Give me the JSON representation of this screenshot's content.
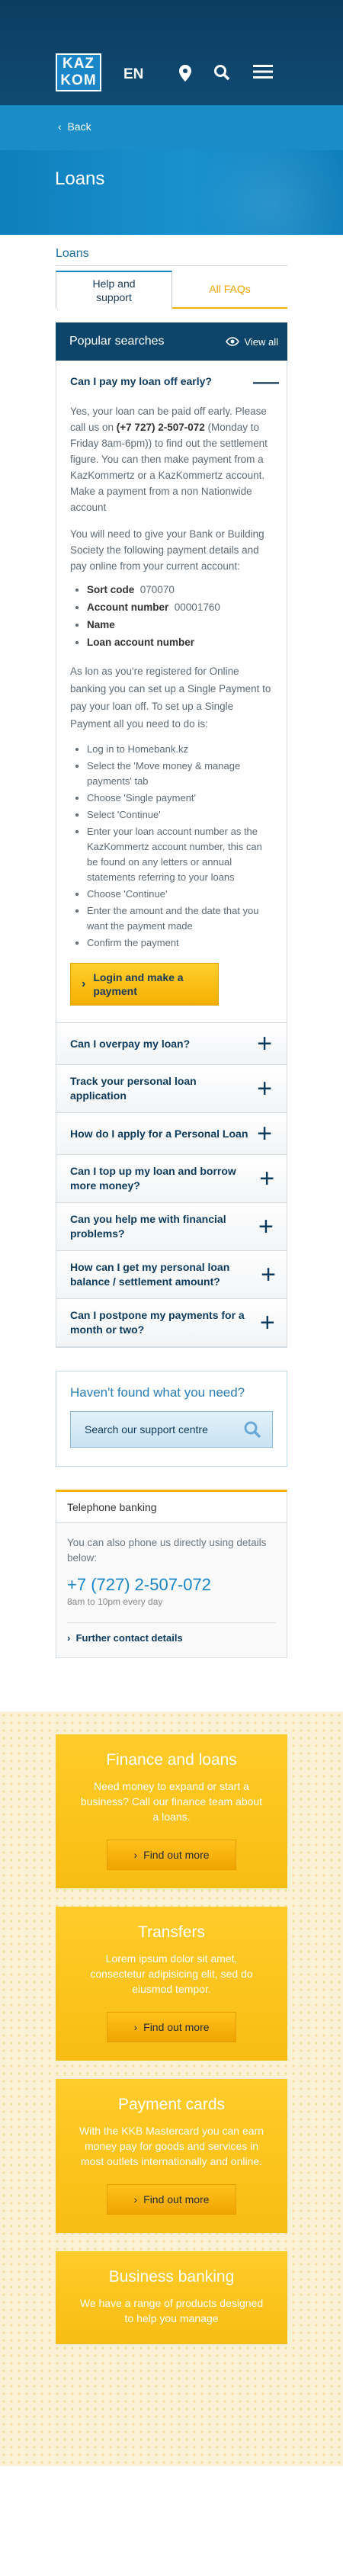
{
  "header": {
    "logo_top": "KAZ",
    "logo_bottom": "KOM",
    "lang": "EN",
    "icons": [
      "location-icon",
      "search-icon",
      "menu-icon"
    ]
  },
  "back_label": "Back",
  "page_title": "Loans",
  "breadcrumb": "Loans",
  "tabs": [
    {
      "label": "Help and support",
      "active": true
    },
    {
      "label": "All FAQs",
      "active": false
    }
  ],
  "faq": {
    "title": "Popular searches",
    "view_all": "View all",
    "open_question": "Can I pay my loan off early?",
    "answer": {
      "p1_a": "Yes, your loan can be paid off early. Please call us on ",
      "p1_phone": "(+7 727) 2-507-072",
      "p1_b": " (Monday to Friday 8am-6pm)) to find out the settlement figure. You can then make payment from a KazKommertz or a KazKommertz account.",
      "p2": "Make a payment from a non Nationwide account",
      "p3": "You will need to give your Bank or Building Society the following payment details and pay online from your current account:",
      "details": [
        {
          "label": "Sort code",
          "value": "070070"
        },
        {
          "label": "Account number",
          "value": "00001760"
        },
        {
          "label": "Name",
          "value": ""
        },
        {
          "label": "Loan account number",
          "value": ""
        }
      ],
      "p4": "As lon as you're registered for Online banking you can set up a Single Payment to pay your loan off. To set up a Single Payment all you need to do is:",
      "steps": [
        "Log in to Homebank.kz",
        "Select the 'Move money & manage payments' tab",
        "Choose 'Single payment'",
        "Select 'Continue'",
        "Enter your loan account number as the KazKommertz account number, this can be found on any letters or annual statements referring to your loans",
        "Choose 'Continue'",
        "Enter the amount and the date that you want the payment made",
        "Confirm the payment"
      ],
      "cta": "Login and make a payment"
    },
    "questions": [
      "Can I overpay my loan?",
      "Track your personal loan application",
      "How do I apply for a Personal Loan",
      "Can I top up my loan and borrow more money?",
      "Can you help me with financial problems?",
      "How can I get my personal loan balance / settlement amount?",
      "Can I postpone my payments for a month or two?"
    ]
  },
  "support": {
    "title": "Haven't found what you need?",
    "search_label": "Search our support centre"
  },
  "telephone": {
    "title": "Telephone banking",
    "text": "You can also phone us directly using details below:",
    "number": "+7 (727) 2-507-072",
    "hours": "8am to 10pm every day",
    "link": "Further contact details"
  },
  "promos": [
    {
      "title": "Finance and loans",
      "text": "Need money to expand or start a business? Call our finance team about a loans.",
      "button": "Find out more"
    },
    {
      "title": "Transfers",
      "text": "Lorem ipsum dolor sit amet, consectetur adipisicing elit, sed do eiusmod tempor.",
      "button": "Find out more"
    },
    {
      "title": "Payment cards",
      "text": "With the KKB Mastercard you can earn money pay for goods and services in most outlets internationally and online.",
      "button": "Find out more"
    },
    {
      "title": "Business banking",
      "text": "We have a range of products designed to help you manage",
      "button": ""
    }
  ],
  "colors": {
    "navy": "#0c4569",
    "blue": "#1a86c7",
    "yellow": "#f8bd12"
  }
}
